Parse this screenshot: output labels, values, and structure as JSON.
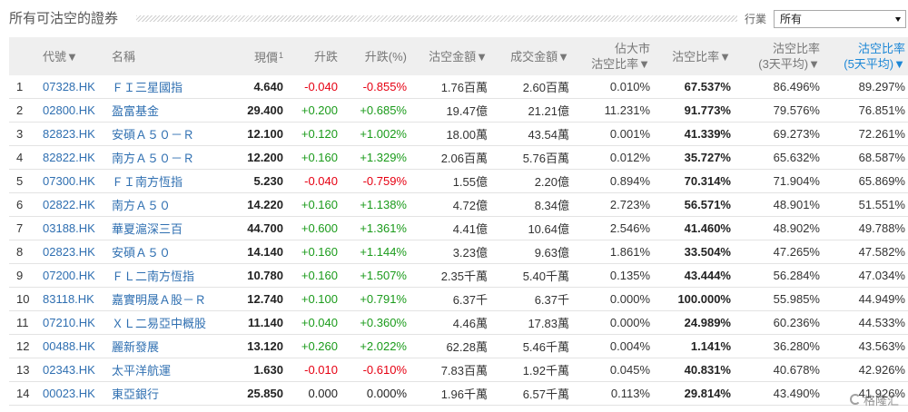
{
  "header": {
    "title": "所有可沽空的證券",
    "industry_label": "行業",
    "industry_selected": "所有"
  },
  "icons": {
    "select_arrow": "chevron-down-icon",
    "watermark_logo": "logo-icon"
  },
  "colors": {
    "link": "#2f6fb1",
    "up": "#1b9b1b",
    "down": "#e60012",
    "active_sort": "#1c87d6",
    "header_bg": "#efefef",
    "row_border": "#e3e3e3"
  },
  "table": {
    "columns": {
      "code": "代號▼",
      "name": "名稱",
      "price": "現價",
      "price_note": "1",
      "change": "升跌",
      "change_pct": "升跌(%)",
      "short_amount": "沽空金額▼",
      "turnover": "成交金額▼",
      "market_short_ratio": [
        "佔大市",
        "沽空比率▼"
      ],
      "short_ratio": "沽空比率▼",
      "short_ratio_3d": [
        "沽空比率",
        "(3天平均)▼"
      ],
      "short_ratio_5d": [
        "沽空比率",
        "(5天平均)▼"
      ]
    },
    "rows": [
      {
        "rank": "1",
        "code": "07328.HK",
        "name": "ＦＩ三星國指",
        "price": "4.640",
        "change": "-0.040",
        "change_pct": "-0.855%",
        "short_amount": "1.76百萬",
        "turnover": "2.60百萬",
        "market_short_ratio": "0.010%",
        "short_ratio": "67.537%",
        "short_ratio_3d": "86.496%",
        "short_ratio_5d": "89.297%"
      },
      {
        "rank": "2",
        "code": "02800.HK",
        "name": "盈富基金",
        "price": "29.400",
        "change": "+0.200",
        "change_pct": "+0.685%",
        "short_amount": "19.47億",
        "turnover": "21.21億",
        "market_short_ratio": "11.231%",
        "short_ratio": "91.773%",
        "short_ratio_3d": "79.576%",
        "short_ratio_5d": "76.851%"
      },
      {
        "rank": "3",
        "code": "82823.HK",
        "name": "安碩Ａ５０－Ｒ",
        "price": "12.100",
        "change": "+0.120",
        "change_pct": "+1.002%",
        "short_amount": "18.00萬",
        "turnover": "43.54萬",
        "market_short_ratio": "0.001%",
        "short_ratio": "41.339%",
        "short_ratio_3d": "69.273%",
        "short_ratio_5d": "72.261%"
      },
      {
        "rank": "4",
        "code": "82822.HK",
        "name": "南方Ａ５０－Ｒ",
        "price": "12.200",
        "change": "+0.160",
        "change_pct": "+1.329%",
        "short_amount": "2.06百萬",
        "turnover": "5.76百萬",
        "market_short_ratio": "0.012%",
        "short_ratio": "35.727%",
        "short_ratio_3d": "65.632%",
        "short_ratio_5d": "68.587%"
      },
      {
        "rank": "5",
        "code": "07300.HK",
        "name": "ＦＩ南方恆指",
        "price": "5.230",
        "change": "-0.040",
        "change_pct": "-0.759%",
        "short_amount": "1.55億",
        "turnover": "2.20億",
        "market_short_ratio": "0.894%",
        "short_ratio": "70.314%",
        "short_ratio_3d": "71.904%",
        "short_ratio_5d": "65.869%"
      },
      {
        "rank": "6",
        "code": "02822.HK",
        "name": "南方Ａ５０",
        "price": "14.220",
        "change": "+0.160",
        "change_pct": "+1.138%",
        "short_amount": "4.72億",
        "turnover": "8.34億",
        "market_short_ratio": "2.723%",
        "short_ratio": "56.571%",
        "short_ratio_3d": "48.901%",
        "short_ratio_5d": "51.551%"
      },
      {
        "rank": "7",
        "code": "03188.HK",
        "name": "華夏滬深三百",
        "price": "44.700",
        "change": "+0.600",
        "change_pct": "+1.361%",
        "short_amount": "4.41億",
        "turnover": "10.64億",
        "market_short_ratio": "2.546%",
        "short_ratio": "41.460%",
        "short_ratio_3d": "48.902%",
        "short_ratio_5d": "49.788%"
      },
      {
        "rank": "8",
        "code": "02823.HK",
        "name": "安碩Ａ５０",
        "price": "14.140",
        "change": "+0.160",
        "change_pct": "+1.144%",
        "short_amount": "3.23億",
        "turnover": "9.63億",
        "market_short_ratio": "1.861%",
        "short_ratio": "33.504%",
        "short_ratio_3d": "47.265%",
        "short_ratio_5d": "47.582%"
      },
      {
        "rank": "9",
        "code": "07200.HK",
        "name": "ＦＬ二南方恆指",
        "price": "10.780",
        "change": "+0.160",
        "change_pct": "+1.507%",
        "short_amount": "2.35千萬",
        "turnover": "5.40千萬",
        "market_short_ratio": "0.135%",
        "short_ratio": "43.444%",
        "short_ratio_3d": "56.284%",
        "short_ratio_5d": "47.034%"
      },
      {
        "rank": "10",
        "code": "83118.HK",
        "name": "嘉實明晟Ａ股－Ｒ",
        "price": "12.740",
        "change": "+0.100",
        "change_pct": "+0.791%",
        "short_amount": "6.37千",
        "turnover": "6.37千",
        "market_short_ratio": "0.000%",
        "short_ratio": "100.000%",
        "short_ratio_3d": "55.985%",
        "short_ratio_5d": "44.949%"
      },
      {
        "rank": "11",
        "code": "07210.HK",
        "name": "ＸＬ二易亞中概股",
        "price": "11.140",
        "change": "+0.040",
        "change_pct": "+0.360%",
        "short_amount": "4.46萬",
        "turnover": "17.83萬",
        "market_short_ratio": "0.000%",
        "short_ratio": "24.989%",
        "short_ratio_3d": "60.236%",
        "short_ratio_5d": "44.533%"
      },
      {
        "rank": "12",
        "code": "00488.HK",
        "name": "麗新發展",
        "price": "13.120",
        "change": "+0.260",
        "change_pct": "+2.022%",
        "short_amount": "62.28萬",
        "turnover": "5.46千萬",
        "market_short_ratio": "0.004%",
        "short_ratio": "1.141%",
        "short_ratio_3d": "36.280%",
        "short_ratio_5d": "43.563%"
      },
      {
        "rank": "13",
        "code": "02343.HK",
        "name": "太平洋航運",
        "price": "1.630",
        "change": "-0.010",
        "change_pct": "-0.610%",
        "short_amount": "7.83百萬",
        "turnover": "1.92千萬",
        "market_short_ratio": "0.045%",
        "short_ratio": "40.831%",
        "short_ratio_3d": "40.678%",
        "short_ratio_5d": "42.926%"
      },
      {
        "rank": "14",
        "code": "00023.HK",
        "name": "東亞銀行",
        "price": "25.850",
        "change": "0.000",
        "change_pct": "0.000%",
        "short_amount": "1.96千萬",
        "turnover": "6.57千萬",
        "market_short_ratio": "0.113%",
        "short_ratio": "29.814%",
        "short_ratio_3d": "43.490%",
        "short_ratio_5d": "41.926%"
      }
    ]
  },
  "watermark": {
    "text": "格隆汇"
  }
}
